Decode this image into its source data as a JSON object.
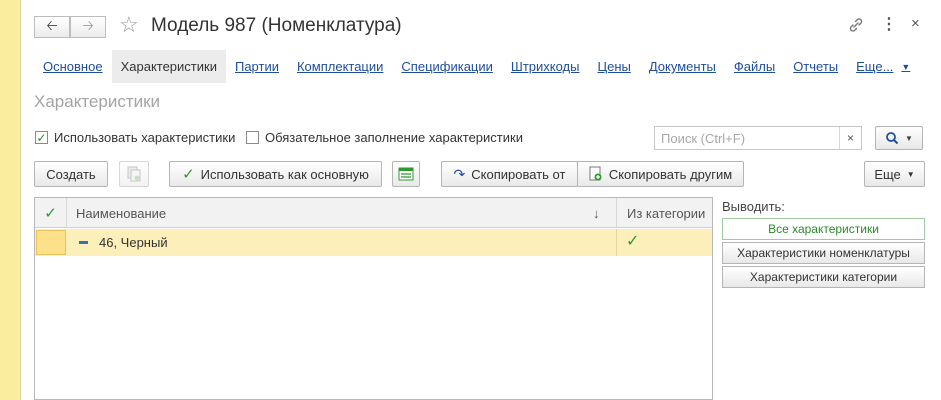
{
  "window": {
    "title": "Модель 987 (Номенклатура)"
  },
  "header_icons": [
    "arrow-left-icon",
    "arrow-right-icon",
    "star-icon",
    "link-icon",
    "more-vertical-icon",
    "close-icon"
  ],
  "tabs": [
    {
      "label": "Основное",
      "active": false
    },
    {
      "label": "Характеристики",
      "active": true
    },
    {
      "label": "Партии",
      "active": false
    },
    {
      "label": "Комплектации",
      "active": false
    },
    {
      "label": "Спецификации",
      "active": false
    },
    {
      "label": "Штрихкоды",
      "active": false
    },
    {
      "label": "Цены",
      "active": false
    },
    {
      "label": "Документы",
      "active": false
    },
    {
      "label": "Файлы",
      "active": false
    },
    {
      "label": "Отчеты",
      "active": false
    },
    {
      "label": "Еще...",
      "active": false
    }
  ],
  "section": {
    "title": "Характеристики"
  },
  "options": {
    "use_characteristics": {
      "label": "Использовать характеристики",
      "checked": true
    },
    "required_fill": {
      "label": "Обязательное заполнение характеристики",
      "checked": false
    }
  },
  "search": {
    "placeholder": "Поиск (Ctrl+F)",
    "clear": "×"
  },
  "toolbar": {
    "create": "Создать",
    "use_as_main": "Использовать как основную",
    "copy_from": "Скопировать от",
    "copy_to_others": "Скопировать другим",
    "more": "Еще"
  },
  "table": {
    "columns": {
      "name": "Наименование",
      "sort": "↓",
      "from_category": "Из категории"
    },
    "rows": [
      {
        "name": "46, Черный",
        "from_category": true
      }
    ]
  },
  "filter": {
    "label": "Выводить:",
    "options": [
      {
        "label": "Все характеристики",
        "selected": true
      },
      {
        "label": "Характеристики номенклатуры",
        "selected": false
      },
      {
        "label": "Характеристики категории",
        "selected": false
      }
    ]
  },
  "colors": {
    "accent_green": "#2e9a2e",
    "link_blue": "#1f4e9d",
    "row_highlight": "#fcefba",
    "frame_yellow": "#fbed9e"
  }
}
